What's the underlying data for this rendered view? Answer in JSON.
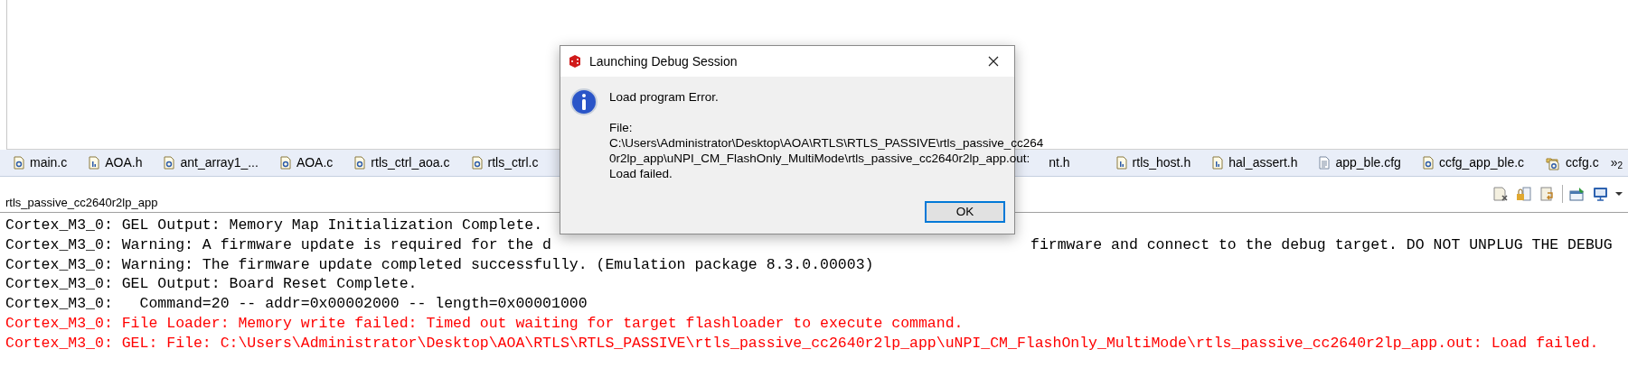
{
  "editor_tabs_left": [
    {
      "label": "main.c",
      "kind": "c"
    },
    {
      "label": "AOA.h",
      "kind": "h"
    },
    {
      "label": "ant_array1_...",
      "kind": "c"
    },
    {
      "label": "AOA.c",
      "kind": "c"
    },
    {
      "label": "rtls_ctrl_aoa.c",
      "kind": "c"
    },
    {
      "label": "rtls_ctrl.c",
      "kind": "c"
    }
  ],
  "editor_tabs_right": [
    {
      "label": "nt.h",
      "kind": "partial"
    },
    {
      "label": "rtls_host.h",
      "kind": "h"
    },
    {
      "label": "hal_assert.h",
      "kind": "h"
    },
    {
      "label": "app_ble.cfg",
      "kind": "text"
    },
    {
      "label": "ccfg_app_ble.c",
      "kind": "c"
    },
    {
      "label": "ccfg.c",
      "kind": "linked"
    }
  ],
  "more_tabs": {
    "symbol": "»",
    "count": "2"
  },
  "console": {
    "title": "rtls_passive_cc2640r2lp_app",
    "lines": [
      {
        "segments": [
          "Cortex_M3_0: GEL Output: Memory Map Initialization Complete."
        ],
        "error": false
      },
      {
        "segments": [
          "Cortex_M3_0: Warning: A firmware update is required for the d",
          "firmware and connect to the debug target. DO NOT UNPLUG THE DEBUG"
        ],
        "error": false
      },
      {
        "segments": [
          "Cortex_M3_0: Warning: The firmware update completed successfully. (Emulation package 8.3.0.00003)"
        ],
        "error": false
      },
      {
        "segments": [
          "Cortex_M3_0: GEL Output: Board Reset Complete."
        ],
        "error": false
      },
      {
        "segments": [
          "Cortex_M3_0:   Command=20 -- addr=0x00002000 -- length=0x00001000"
        ],
        "error": false
      },
      {
        "segments": [
          "Cortex_M3_0: File Loader: Memory write failed: Timed out waiting for target flashloader to execute command."
        ],
        "error": true
      },
      {
        "segments": [
          "Cortex_M3_0: GEL: File: C:\\Users\\Administrator\\Desktop\\AOA\\RTLS\\RTLS_PASSIVE\\rtls_passive_cc2640r2lp_app\\uNPI_CM_FlashOnly_MultiMode\\rtls_passive_cc2640r2lp_app.out: Load failed."
        ],
        "error": true
      }
    ]
  },
  "dialog": {
    "title": "Launching Debug Session",
    "heading": "Load program Error.",
    "message": [
      "File:",
      "C:\\Users\\Administrator\\Desktop\\AOA\\RTLS\\RTLS_PASSIVE\\rtls_passive_cc264",
      "0r2lp_app\\uNPI_CM_FlashOnly_MultiMode\\rtls_passive_cc2640r2lp_app.out:",
      "Load failed."
    ],
    "buttons": [
      "OK"
    ]
  }
}
